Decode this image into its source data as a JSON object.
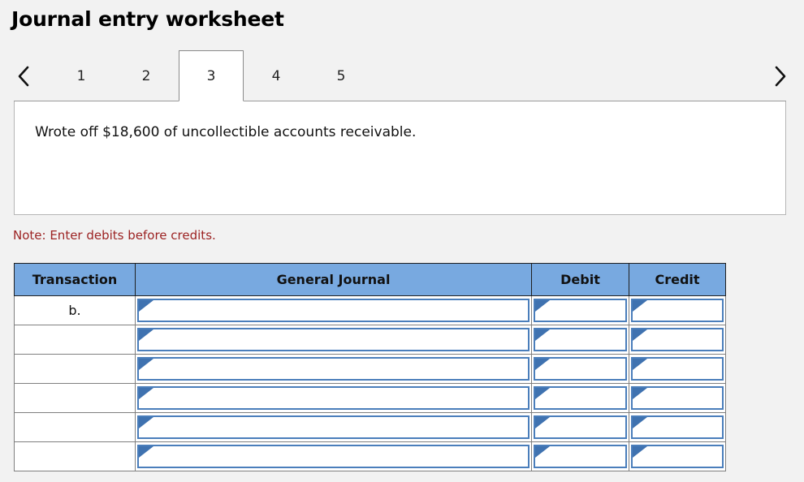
{
  "header": {
    "title": "Journal entry worksheet"
  },
  "nav": {
    "prev_label": "‹",
    "next_label": "›",
    "prev_name": "previous-worksheet",
    "next_name": "next-worksheet"
  },
  "tabs": [
    {
      "label": "1",
      "active": false
    },
    {
      "label": "2",
      "active": false
    },
    {
      "label": "3",
      "active": true
    },
    {
      "label": "4",
      "active": false
    },
    {
      "label": "5",
      "active": false
    }
  ],
  "content": {
    "description": "Wrote off $18,600 of uncollectible accounts receivable."
  },
  "note": {
    "text": "Note: Enter debits before credits."
  },
  "table": {
    "columns": [
      "Transaction",
      "General Journal",
      "Debit",
      "Credit"
    ],
    "rows": [
      {
        "transaction": "b.",
        "general_journal": "",
        "debit": "",
        "credit": ""
      },
      {
        "transaction": "",
        "general_journal": "",
        "debit": "",
        "credit": ""
      },
      {
        "transaction": "",
        "general_journal": "",
        "debit": "",
        "credit": ""
      },
      {
        "transaction": "",
        "general_journal": "",
        "debit": "",
        "credit": ""
      },
      {
        "transaction": "",
        "general_journal": "",
        "debit": "",
        "credit": ""
      },
      {
        "transaction": "",
        "general_journal": "",
        "debit": "",
        "credit": ""
      }
    ]
  },
  "colors": {
    "header_blue": "#78a9e0",
    "field_border_blue": "#4a7ebb",
    "note_red": "#9c2323",
    "page_bg": "#f2f2f2"
  }
}
